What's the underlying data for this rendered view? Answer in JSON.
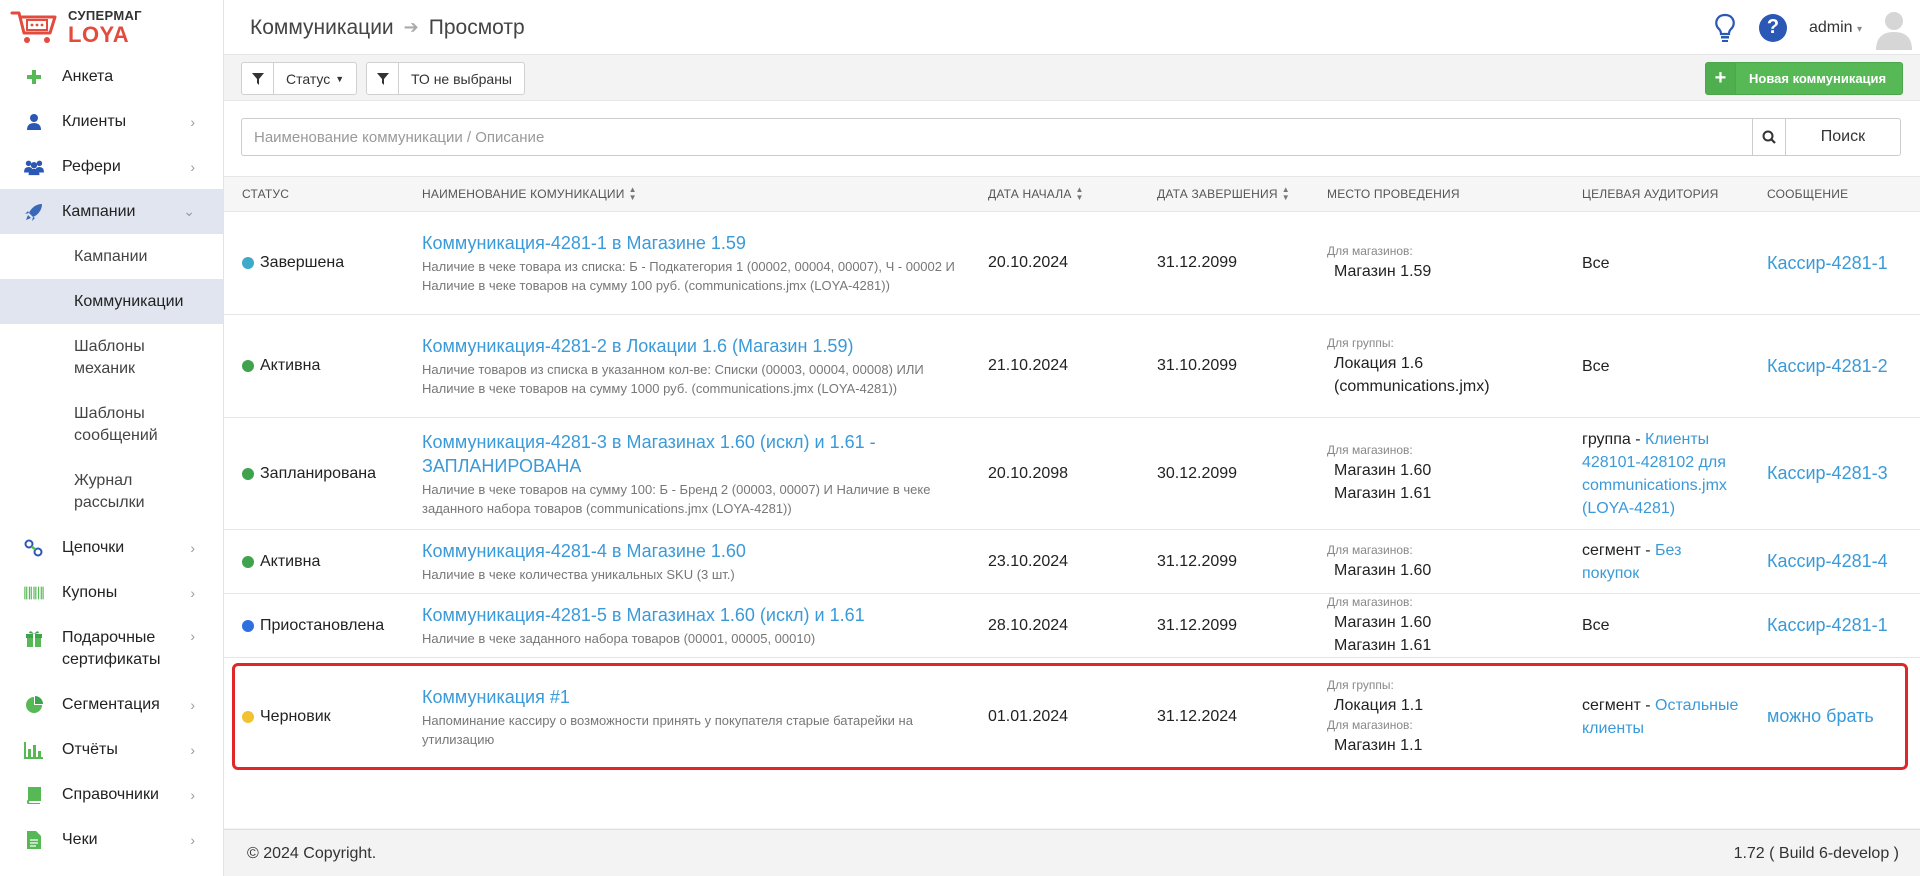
{
  "brand": {
    "line1": "СУПЕРМАГ",
    "line2": "LOYA"
  },
  "breadcrumb": {
    "section": "Коммуникации",
    "page": "Просмотр"
  },
  "user": {
    "name": "admin"
  },
  "sidebar": {
    "items": [
      {
        "label": "Анкета"
      },
      {
        "label": "Клиенты"
      },
      {
        "label": "Рефери"
      },
      {
        "label": "Кампании"
      },
      {
        "label": "Цепочки"
      },
      {
        "label": "Купоны"
      },
      {
        "label": "Подарочные сертификаты"
      },
      {
        "label": "Сегментация"
      },
      {
        "label": "Отчёты"
      },
      {
        "label": "Справочники"
      },
      {
        "label": "Чеки"
      }
    ],
    "sub_items": [
      {
        "label": "Кампании"
      },
      {
        "label": "Коммуникации"
      },
      {
        "label": "Шаблоны механик"
      },
      {
        "label": "Шаблоны сообщений"
      },
      {
        "label": "Журнал рассылки"
      }
    ]
  },
  "toolbar": {
    "status_filter": "Статус",
    "to_filter": "ТО не выбраны",
    "new_button": "Новая коммуникация"
  },
  "search": {
    "placeholder": "Наименование коммуникации / Описание",
    "button": "Поиск"
  },
  "table": {
    "columns": {
      "status": "Статус",
      "name": "Наименование комуникации",
      "start": "Дата начала",
      "end": "Дата завершения",
      "place": "Место проведения",
      "audience": "Целевая аудитория",
      "message": "Сообщение"
    },
    "rows": [
      {
        "status": "Завершена",
        "status_color": "#3fa9c9",
        "name": "Коммуникация-4281-1 в Магазине 1.59",
        "desc": "Наличие в чеке товара из списка: Б - Подкатегория 1 (00002, 00004, 00007), Ч - 00002 И Наличие в чеке товаров на сумму 100 руб. (communications.jmx (LOYA-4281))",
        "start": "20.10.2024",
        "end": "31.12.2099",
        "place_label_1": "Для магазинов:",
        "place_1": "Магазин 1.59",
        "audience": "Все",
        "message": "Кассир-4281-1"
      },
      {
        "status": "Активна",
        "status_color": "#3fa34d",
        "name": "Коммуникация-4281-2 в Локации 1.6 (Магазин 1.59)",
        "desc": "Наличие товаров из списка в указанном кол-ве: Списки (00003, 00004, 00008) ИЛИ Наличие в чеке товаров на сумму 1000 руб. (communications.jmx (LOYA-4281))",
        "start": "21.10.2024",
        "end": "31.10.2099",
        "place_label_1": "Для группы:",
        "place_1": "Локация 1.6 (communications.jmx)",
        "audience": "Все",
        "message": "Кассир-4281-2"
      },
      {
        "status": "Запланирована",
        "status_color": "#3fa34d",
        "name": "Коммуникация-4281-3 в Магазинах 1.60 (искл) и 1.61 - ЗАПЛАНИРОВАНА",
        "desc": "Наличие в чеке товаров на сумму 100: Б - Бренд 2 (00003, 00007) И Наличие в чеке заданного набора товаров (communications.jmx (LOYA-4281))",
        "start": "20.10.2098",
        "end": "30.12.2099",
        "place_label_1": "Для магазинов:",
        "place_1": "Магазин 1.60",
        "place_2": "Магазин 1.61",
        "audience_prefix": "группа - ",
        "audience_link": "Клиенты 428101-428102 для communications.jmx (LOYA-4281)",
        "message": "Кассир-4281-3"
      },
      {
        "status": "Активна",
        "status_color": "#3fa34d",
        "name": "Коммуникация-4281-4 в Магазине 1.60",
        "desc": "Наличие в чеке количества уникальных SKU (3 шт.)",
        "start": "23.10.2024",
        "end": "31.12.2099",
        "place_label_1": "Для магазинов:",
        "place_1": "Магазин 1.60",
        "audience_prefix": "сегмент - ",
        "audience_link": "Без покупок",
        "message": "Кассир-4281-4"
      },
      {
        "status": "Приостановлена",
        "status_color": "#2f6fe0",
        "name": "Коммуникация-4281-5 в Магазинах 1.60 (искл) и 1.61",
        "desc": "Наличие в чеке заданного набора товаров (00001, 00005, 00010)",
        "start": "28.10.2024",
        "end": "31.12.2099",
        "place_label_1": "Для магазинов:",
        "place_1": "Магазин 1.60",
        "place_2": "Магазин 1.61",
        "audience": "Все",
        "message": "Кассир-4281-1"
      },
      {
        "status": "Черновик",
        "status_color": "#f2c230",
        "name": "Коммуникация #1",
        "desc": "Напоминание кассиру о возможности принять у покупателя старые батарейки на утилизацию",
        "start": "01.01.2024",
        "end": "31.12.2024",
        "place_label_1": "Для группы:",
        "place_1": "Локация 1.1",
        "place_label_2": "Для магазинов:",
        "place_2": "Магазин 1.1",
        "audience_prefix": "сегмент - ",
        "audience_link": "Остальные клиенты",
        "message": "можно брать"
      }
    ]
  },
  "footer": {
    "copyright": "© 2024 Copyright.",
    "version": "1.72 ( Build 6-develop )"
  },
  "colors": {
    "accent": "#3a9ad9",
    "success": "#57b956",
    "highlight": "#e02626",
    "active_nav": "#e1e5ef"
  }
}
